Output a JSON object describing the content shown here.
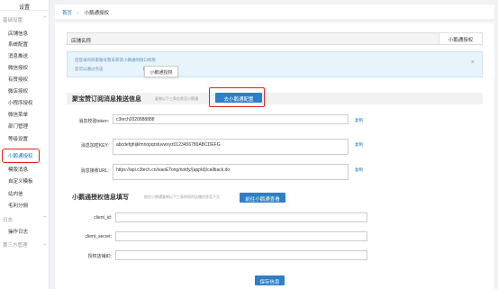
{
  "sidebar": {
    "top_item": "设置",
    "groups": [
      {
        "label": "基础设置",
        "toggle": "⌃",
        "items": [
          "店铺信息",
          "系统配置",
          "消息推送",
          "微信授权",
          "有赞授权",
          "微店授权",
          "小程序授权",
          "微信菜单",
          "部门管理",
          "等级设置",
          "小鹅通授权",
          "模版消息",
          "自定义模板",
          "站内信",
          "毛利分佣"
        ]
      },
      {
        "label": "日志",
        "toggle": "⌃",
        "items": [
          "操作日志"
        ]
      },
      {
        "label": "第三方管理",
        "toggle": "⌄",
        "items": []
      }
    ]
  },
  "breadcrumb": {
    "home": "首页",
    "separator": "/",
    "current": "小鹅通授权"
  },
  "store": {
    "label": "店铺名称",
    "value": "小鹅通授权"
  },
  "notice": {
    "line1": "您登录的商家账号暂未获得小鹅通的接口权限",
    "line2": "您可以通过点击",
    "line2_suffix": "获取并进行授权",
    "close": "×",
    "tooltip": "小鹅通授权"
  },
  "push_section": {
    "title": "聚宝赞订阅消息推送信息",
    "hint": "复制以下三条信息至小鹅通",
    "button": "去小鹅通配置",
    "fields": [
      {
        "label": "消息校验token:",
        "value": "c3tech2020888888",
        "copy": "复制"
      },
      {
        "label": "消息加密KEY:",
        "value": "abcdefghijklmnopqrstuvwxyz0123456789ABCDEFG",
        "copy": "复制"
      },
      {
        "label": "消息接收URL:",
        "value": "https://api.c3tech.cn/xiaoETong/notify/{appId}/callback.do",
        "copy": "复制"
      }
    ]
  },
  "auth_section": {
    "title": "小鹅通授权信息填写",
    "hint": "前往小鹅通复制以下三条授权的店铺信息至下方",
    "button": "前往小鹅通查看",
    "fields": [
      {
        "label": "client_id:",
        "value": ""
      },
      {
        "label": "client_secret:",
        "value": ""
      },
      {
        "label": "授权店铺ID:",
        "value": ""
      }
    ]
  },
  "save_button": "保存信息"
}
